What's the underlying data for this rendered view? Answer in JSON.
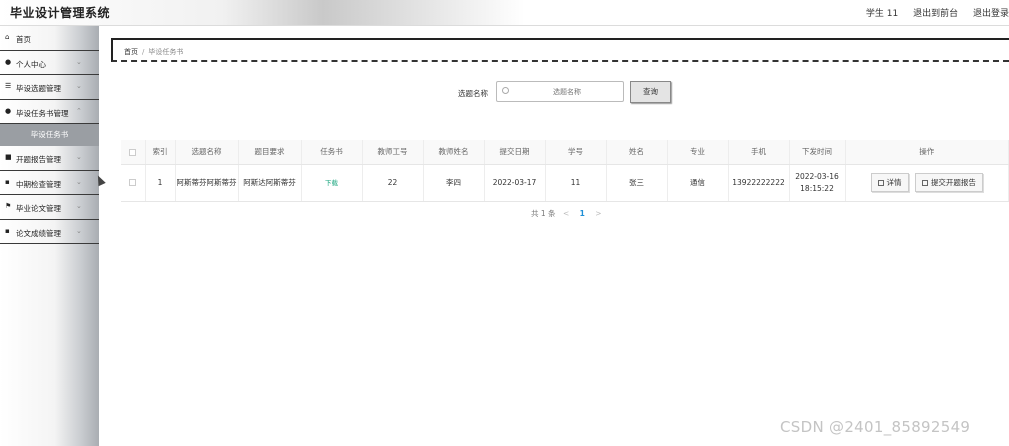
{
  "header": {
    "app_title": "毕业设计管理系统",
    "user": "学生 11",
    "back_to_front": "退出到前台",
    "logout": "退出登录"
  },
  "sidebar": {
    "items": [
      {
        "icon": "home-icon",
        "label": "首页",
        "expandable": false
      },
      {
        "icon": "user-icon",
        "label": "个人中心",
        "expandable": true
      },
      {
        "icon": "list-icon",
        "label": "毕设选题管理",
        "expandable": true
      },
      {
        "icon": "user-icon",
        "label": "毕设任务书管理",
        "expandable": true
      },
      {
        "icon": "briefcase-icon",
        "label": "开题报告管理",
        "expandable": true
      },
      {
        "icon": "grid-icon",
        "label": "中期检查管理",
        "expandable": true
      },
      {
        "icon": "flag-icon",
        "label": "毕业论文管理",
        "expandable": true
      },
      {
        "icon": "grid-icon",
        "label": "论文成绩管理",
        "expandable": true
      }
    ],
    "active_sub_item": "毕设任务书"
  },
  "breadcrumb": {
    "home": "首页",
    "separator": "/",
    "current": "毕设任务书"
  },
  "search": {
    "label": "选题名称",
    "placeholder": "选题名称",
    "button_label": "查询"
  },
  "table": {
    "columns": [
      "",
      "索引",
      "选题名称",
      "题目要求",
      "任务书",
      "教师工号",
      "教师姓名",
      "提交日期",
      "学号",
      "姓名",
      "专业",
      "手机",
      "下发时间",
      "操作"
    ],
    "rows": [
      {
        "index": "1",
        "topic_name": "阿斯蒂芬阿斯蒂芬",
        "requirements": "阿斯达阿斯蒂芬",
        "task_book": "下载",
        "teacher_id": "22",
        "teacher_name": "李四",
        "submit_date": "2022-03-17",
        "student_id": "11",
        "student_name": "张三",
        "major": "通信",
        "phone": "13922222222",
        "issue_time": "2022-03-16 18:15:22",
        "actions": [
          "详情",
          "提交开题报告"
        ]
      }
    ]
  },
  "pagination": {
    "total_text": "共 1 条",
    "prev": "<",
    "current_page": "1",
    "next": ">"
  },
  "watermark": "CSDN @2401_85892549"
}
